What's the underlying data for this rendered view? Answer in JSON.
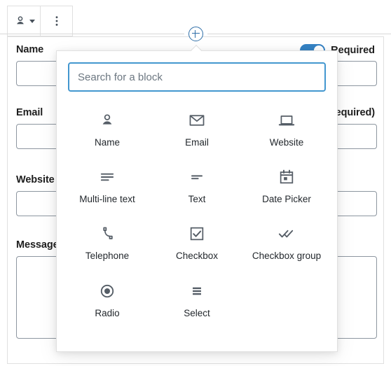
{
  "toolbar": {
    "block_type_icon": "person-icon",
    "block_type_label": "Name block",
    "options_icon": "vertical-dots-icon",
    "options_label": "More options"
  },
  "inserter": {
    "plus_icon": "plus-circle-icon",
    "plus_label": "Add block"
  },
  "form": {
    "required_toggle": {
      "label": "Required",
      "enabled": true,
      "accent_color": "#3582c4"
    },
    "fields": [
      {
        "label": "Name",
        "required_note": "",
        "type": "text"
      },
      {
        "label": "Email",
        "required_note": "(required)",
        "type": "text"
      },
      {
        "label": "Website",
        "required_note": "",
        "type": "text"
      },
      {
        "label": "Message",
        "required_note": "",
        "type": "textarea"
      }
    ],
    "required_note_color": "#cc4444"
  },
  "popover": {
    "search": {
      "placeholder": "Search for a block",
      "value": "",
      "focus_color": "#4397cf"
    },
    "blocks": [
      {
        "label": "Name",
        "icon": "person-icon"
      },
      {
        "label": "Email",
        "icon": "envelope-icon"
      },
      {
        "label": "Website",
        "icon": "laptop-icon"
      },
      {
        "label": "Multi-line text",
        "icon": "text-lines-icon"
      },
      {
        "label": "Text",
        "icon": "short-text-icon"
      },
      {
        "label": "Date Picker",
        "icon": "calendar-icon"
      },
      {
        "label": "Telephone",
        "icon": "phone-icon"
      },
      {
        "label": "Checkbox",
        "icon": "checkbox-icon"
      },
      {
        "label": "Checkbox group",
        "icon": "double-check-icon"
      },
      {
        "label": "Radio",
        "icon": "radio-button-icon"
      },
      {
        "label": "Select",
        "icon": "select-lines-icon"
      }
    ]
  }
}
